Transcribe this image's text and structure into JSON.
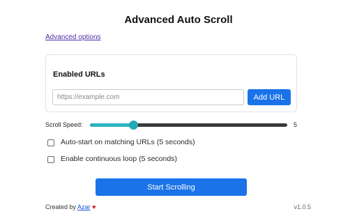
{
  "title": "Advanced Auto Scroll",
  "advanced_options_link": "Advanced options",
  "enabled_urls": {
    "heading": "Enabled URLs",
    "url_input_value": "",
    "url_input_placeholder": "https://example.com",
    "add_button_label": "Add URL"
  },
  "scroll_speed": {
    "label": "Scroll Speed:",
    "value": "5",
    "slider_fraction": 0.22,
    "track_color": "#3a3a3a",
    "fill_color": "#2bb3c0"
  },
  "options": [
    {
      "label": "Auto-start on matching URLs (5 seconds)",
      "checked": false
    },
    {
      "label": "Enable continuous loop (5 seconds)",
      "checked": false
    }
  ],
  "start_button_label": "Start Scrolling",
  "footer": {
    "created_by": "Created by",
    "author": "Azar",
    "heart_icon": "heart-icon",
    "version": "v1.0.5"
  },
  "colors": {
    "accent": "#1a73e8",
    "link": "#4b2fa8",
    "heart": "#d2141c"
  }
}
